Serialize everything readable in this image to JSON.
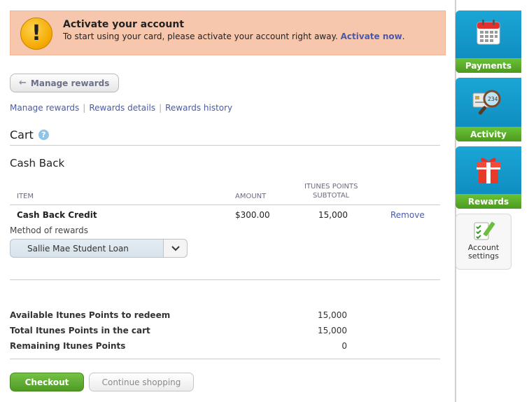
{
  "alert": {
    "title": "Activate your account",
    "text": "To start using your card, please activate your account right away.",
    "link": "Activate now",
    "link_suffix": "."
  },
  "nav": {
    "back_button": "Manage rewards",
    "links": [
      "Manage rewards",
      "Rewards details",
      "Rewards history"
    ],
    "separator": "|"
  },
  "cart": {
    "title": "Cart",
    "help": "?",
    "section_title": "Cash Back",
    "columns": {
      "item": "ITEM",
      "amount": "AMOUNT",
      "points_line1": "ITUNES POINTS",
      "points_line2": "SUBTOTAL"
    },
    "row": {
      "item": "Cash Back Credit",
      "amount": "$300.00",
      "points": "15,000",
      "remove": "Remove"
    },
    "method_label": "Method of rewards",
    "method_value": "Sallie Mae Student Loan"
  },
  "summary": [
    {
      "label": "Available Itunes Points to redeem",
      "value": "15,000"
    },
    {
      "label": "Total Itunes Points in the cart",
      "value": "15,000"
    },
    {
      "label": "Remaining Itunes Points",
      "value": "0"
    }
  ],
  "actions": {
    "checkout": "Checkout",
    "continue": "Continue shopping"
  },
  "sidebar": {
    "payments": "Payments",
    "activity": "Activity",
    "rewards": "Rewards",
    "settings_line1": "Account",
    "settings_line2": "settings",
    "calendar_num": "234"
  },
  "colors": {
    "alert_bg": "#f7c7ad",
    "link": "#4a5aa8",
    "tile_blue": "#1aa6d6",
    "tile_green": "#6bc238"
  }
}
